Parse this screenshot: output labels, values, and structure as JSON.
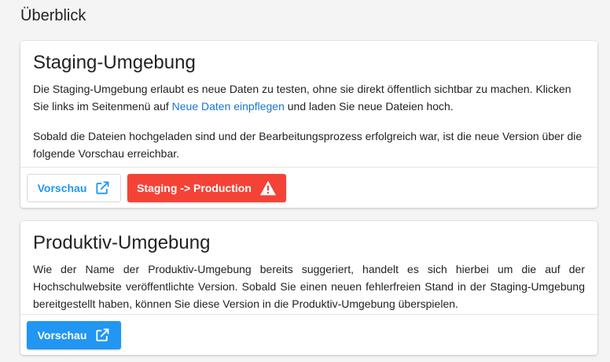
{
  "page": {
    "title": "Überblick"
  },
  "staging": {
    "title": "Staging-Umgebung",
    "text_before_link": "Die Staging-Umgebung erlaubt es neue Daten zu testen, ohne sie direkt öffentlich sichtbar zu machen. Klicken Sie links im Seitenmenü auf ",
    "link_label": "Neue Daten einpflegen",
    "text_after_link": " und laden Sie neue Dateien hoch.",
    "paragraph2": "Sobald die Dateien hochgeladen sind und der Bearbeitungsprozess erfolgreich war, ist die neue Version über die folgende Vorschau erreichbar.",
    "preview_label": "Vorschau",
    "deploy_label": "Staging -> Production"
  },
  "production": {
    "title": "Produktiv-Umgebung",
    "text": "Wie der Name der Produktiv-Umgebung bereits suggeriert, handelt es sich hierbei um die auf der Hochschulwebsite veröffentlichte Version. Sobald Sie einen neuen fehlerfreien Stand in der Staging-Umgebung bereitgestellt haben, können Sie diese Version in die Produktiv-Umgebung überspielen.",
    "preview_label": "Vorschau"
  },
  "icons": {
    "preview": "open-in-new-icon",
    "warning": "warning-icon"
  },
  "colors": {
    "primary": "#2196f3",
    "danger": "#f44336",
    "link": "#1976d2",
    "background": "#f4f4f4"
  }
}
